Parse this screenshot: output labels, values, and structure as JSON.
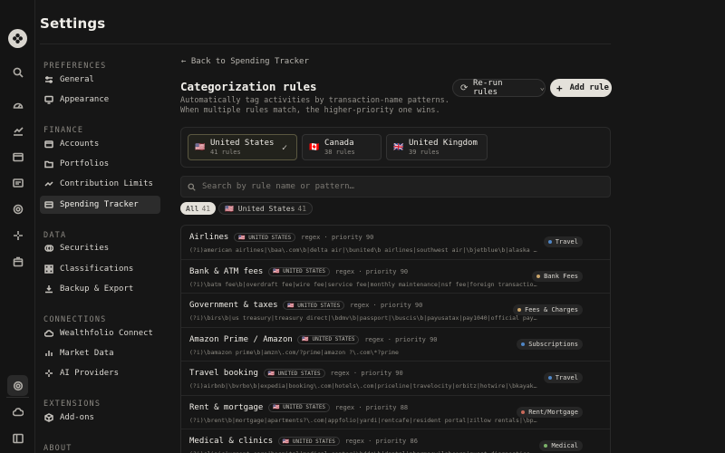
{
  "header": {
    "title": "Settings"
  },
  "nav": {
    "sections": [
      {
        "label": "PREFERENCES",
        "items": [
          {
            "label": "General",
            "icon": "sliders-icon"
          },
          {
            "label": "Appearance",
            "icon": "monitor-icon"
          }
        ]
      },
      {
        "label": "FINANCE",
        "items": [
          {
            "label": "Accounts",
            "icon": "wallet-icon"
          },
          {
            "label": "Portfolios",
            "icon": "folder-icon"
          },
          {
            "label": "Contribution Limits",
            "icon": "trend-icon"
          },
          {
            "label": "Spending Tracker",
            "icon": "card-icon",
            "active": true
          }
        ]
      },
      {
        "label": "DATA",
        "items": [
          {
            "label": "Securities",
            "icon": "coins-icon"
          },
          {
            "label": "Classifications",
            "icon": "grid-icon"
          },
          {
            "label": "Backup & Export",
            "icon": "download-icon"
          }
        ]
      },
      {
        "label": "CONNECTIONS",
        "items": [
          {
            "label": "Wealthfolio Connect",
            "icon": "cloud-icon"
          },
          {
            "label": "Market Data",
            "icon": "bars-icon"
          },
          {
            "label": "AI Providers",
            "icon": "sparkle-icon"
          }
        ]
      },
      {
        "label": "EXTENSIONS",
        "items": [
          {
            "label": "Add-ons",
            "icon": "box-icon"
          }
        ]
      },
      {
        "label": "ABOUT",
        "items": []
      }
    ]
  },
  "main": {
    "back_label": "Back to Spending Tracker",
    "title": "Categorization rules",
    "description": "Automatically tag activities by transaction-name patterns. When multiple rules match, the higher-priority one wins.",
    "rerun_label": "Re-run rules",
    "add_label": "Add rule",
    "regions": [
      {
        "flag": "🇺🇸",
        "name": "United States",
        "count": "41 rules",
        "active": true
      },
      {
        "flag": "🇨🇦",
        "name": "Canada",
        "count": "38 rules",
        "active": false
      },
      {
        "flag": "🇬🇧",
        "name": "United Kingdom",
        "count": "39 rules",
        "active": false
      }
    ],
    "search_placeholder": "Search by rule name or pattern…",
    "filters": {
      "all": {
        "label": "All",
        "count": "41"
      },
      "us": {
        "label": "🇺🇸 United States",
        "count": "41"
      }
    },
    "rule_region_tag": "🇺🇸 UNITED STATES",
    "rules": [
      {
        "name": "Airlines",
        "meta": "regex · priority 90",
        "pattern": "(?i)american airlines|\\baa\\.com\\b|delta air|\\bunited\\b airlines|southwest air|\\bjetblue\\b|alaska airlines",
        "category": "Travel",
        "color": "#4f86c6"
      },
      {
        "name": "Bank & ATM fees",
        "meta": "regex · priority 90",
        "pattern": "(?i)\\batm fee\\b|overdraft fee|wire fee|service fee|monthly maintenance|nsf fee|foreign transaction fee",
        "category": "Bank Fees",
        "color": "#c9a46a"
      },
      {
        "name": "Government & taxes",
        "meta": "regex · priority 90",
        "pattern": "(?i)\\birs\\b|us treasury|treasury direct|\\bdmv\\b|passport|\\buscis\\b|payusatax|pay1040|official payments",
        "category": "Fees & Charges",
        "color": "#c9a46a"
      },
      {
        "name": "Amazon Prime / Amazon",
        "meta": "regex · priority 90",
        "pattern": "(?i)\\bamazon prime\\b|amzn\\.com/?prime|amazon ?\\.com\\*?prime",
        "category": "Subscriptions",
        "color": "#4f86c6"
      },
      {
        "name": "Travel booking",
        "meta": "regex · priority 90",
        "pattern": "(?i)airbnb|\\bvrbo\\b|expedia|booking\\.com|hotels\\.com|priceline|travelocity|orbitz|hotwire|\\bkayak\\b|trivago",
        "category": "Travel",
        "color": "#4f86c6"
      },
      {
        "name": "Rent & mortgage",
        "meta": "regex · priority 88",
        "pattern": "(?i)\\brent\\b|mortgage|apartments?\\.com|appfolio|yardi|rentcafe|resident portal|zillow rentals|\\bpmt\\b",
        "category": "Rent/Mortgage",
        "color": "#c96a5a"
      },
      {
        "name": "Medical & clinics",
        "meta": "regex · priority 86",
        "pattern": "(?i)clinic|urgent care|hospital|medical center|\\bdds\\b|dental|pharmacy|labcorp|quest diagnostics",
        "category": "Medical",
        "color": "#7bb26a"
      }
    ]
  }
}
